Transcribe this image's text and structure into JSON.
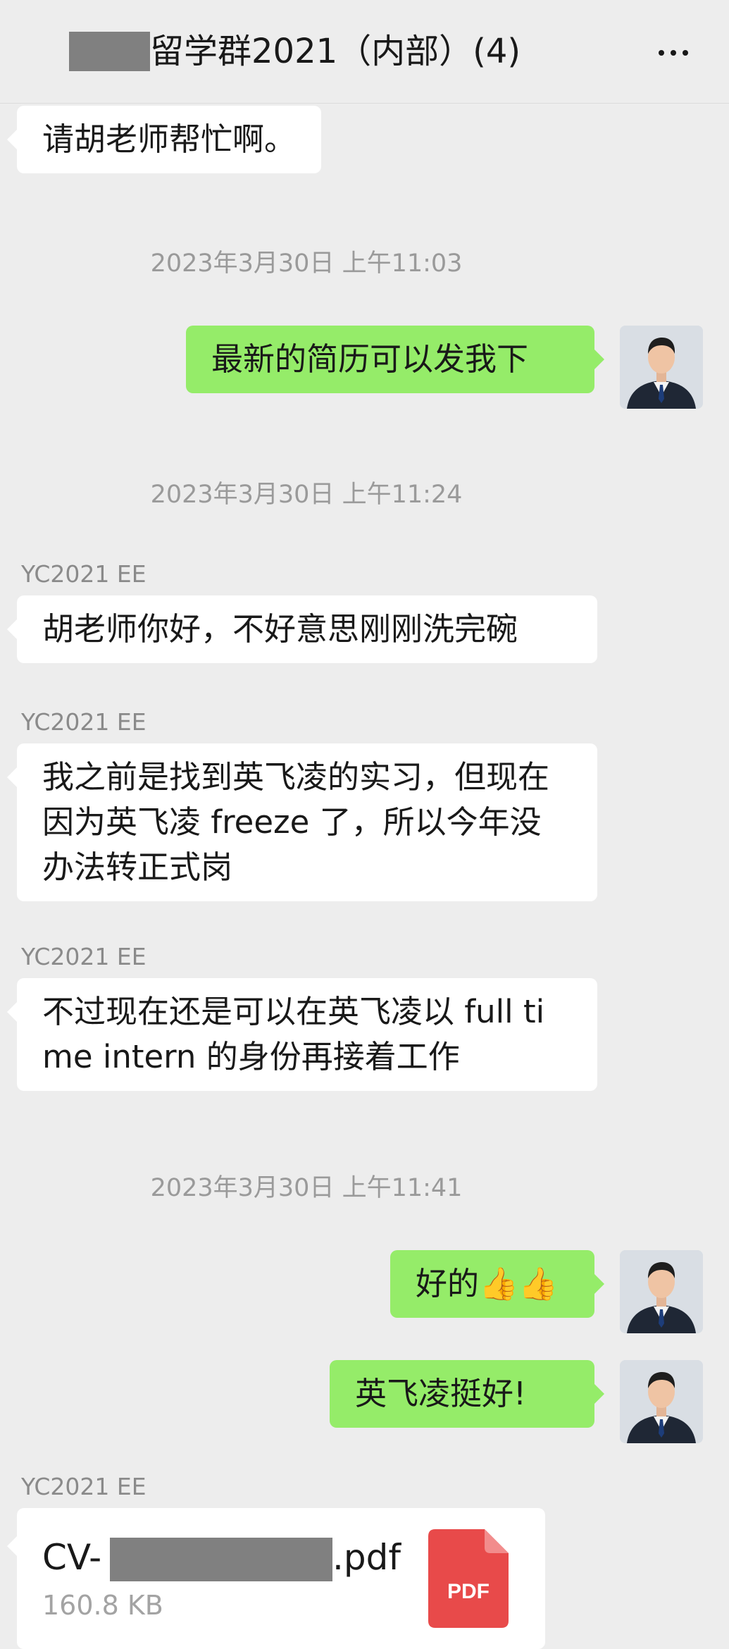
{
  "header": {
    "title": "留学群2021（内部）(4)",
    "more_icon": "more-horizontal-icon"
  },
  "messages": {
    "m0": "请胡老师帮忙啊。",
    "ts1": "2023年3月30日 上午11:03",
    "m1": "最新的简历可以发我下",
    "ts2": "2023年3月30日 上午11:24",
    "sender": "YC2021 EE",
    "m2": "胡老师你好，不好意思刚刚洗完碗",
    "m3": "我之前是找到英飞凌的实习，但现在因为英飞凌 freeze 了，所以今年没办法转正式岗",
    "m4": "不过现在还是可以在英飞凌以 full time intern 的身份再接着工作",
    "ts3": "2023年3月30日 上午11:41",
    "m5_text": "好的",
    "m5_emoji": "👍👍",
    "m6": "英飞凌挺好!"
  },
  "file": {
    "name_prefix": "CV-",
    "name_suffix": ".pdf",
    "size": "160.8 KB",
    "badge": "PDF"
  },
  "colors": {
    "background": "#ededed",
    "outgoing_bubble": "#95ec69",
    "incoming_bubble": "#ffffff",
    "pdf_red": "#e84a4a"
  }
}
